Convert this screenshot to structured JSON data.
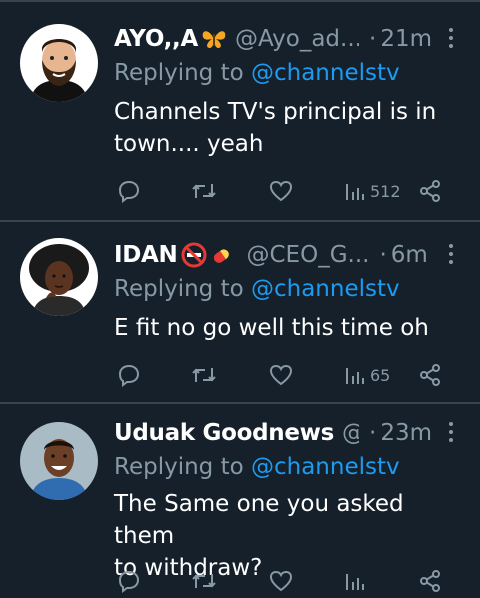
{
  "tweets": [
    {
      "name": "AYO,,A",
      "emoji": "butterfly-emoji",
      "handle": "@Ayo_ad...",
      "dot": "·",
      "time": "21m",
      "replying_prefix": "Replying to ",
      "replying_to": "@channelstv",
      "text_lines": [
        "Channels TV's principal is in",
        "town.... yeah"
      ],
      "views": "512",
      "avatar": "bearded-man-avatar"
    },
    {
      "name": "IDAN",
      "emoji": "no-smoking-pill-emoji",
      "handle": "@CEO_G...",
      "dot": "·",
      "time": "6m",
      "replying_prefix": "Replying to ",
      "replying_to": "@channelstv",
      "text_lines": [
        "E fit no go well this time oh"
      ],
      "views": "65",
      "avatar": "woman-avatar"
    },
    {
      "name": "Uduak Goodnews",
      "emoji": "",
      "handle": "@...",
      "dot": "·",
      "time": "23m",
      "replying_prefix": "Replying to ",
      "replying_to": "@channelstv",
      "text_lines": [
        "The Same one you asked them",
        "to withdraw?"
      ],
      "views": "",
      "avatar": "smiling-man-avatar"
    }
  ],
  "colors": {
    "background": "#15202b",
    "divider": "#38444d",
    "secondary_text": "#8899a6",
    "link": "#1d9bf0"
  }
}
